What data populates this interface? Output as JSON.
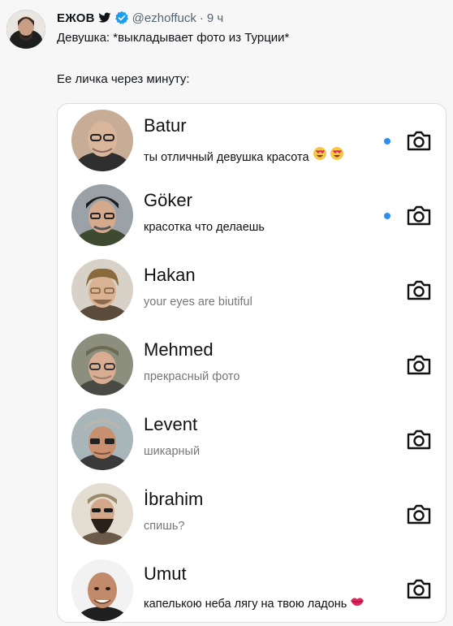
{
  "header": {
    "top_clip": "",
    "name": "ЕЖОВ",
    "handle": "@ezhoffuck",
    "separator": "·",
    "time": "9 ч"
  },
  "tweet": {
    "line1": "Девушка: *выкладывает фото из Турции*",
    "line2": "Ее личка через минуту:"
  },
  "chats": [
    {
      "name": "Batur",
      "message": "ты отличный девушка красота",
      "unread": true,
      "seen": false,
      "emoji": "heart-eyes"
    },
    {
      "name": "Göker",
      "message": "красотка что делаешь",
      "unread": true,
      "seen": false,
      "emoji": ""
    },
    {
      "name": "Hakan",
      "message": "your eyes are biutiful",
      "unread": false,
      "seen": true,
      "emoji": ""
    },
    {
      "name": "Mehmed",
      "message": "прекрасный фото",
      "unread": false,
      "seen": true,
      "emoji": ""
    },
    {
      "name": "Levent",
      "message": "шикарный",
      "unread": false,
      "seen": true,
      "emoji": ""
    },
    {
      "name": "İbrahim",
      "message": "спишь?",
      "unread": false,
      "seen": true,
      "emoji": ""
    },
    {
      "name": "Umut",
      "message": "капелькою неба лягу на твою ладонь",
      "unread": false,
      "seen": true,
      "emoji": "kiss-lips"
    }
  ],
  "colors": {
    "verified": "#1d9bf0",
    "unread_dot": "#2b8ef0"
  }
}
